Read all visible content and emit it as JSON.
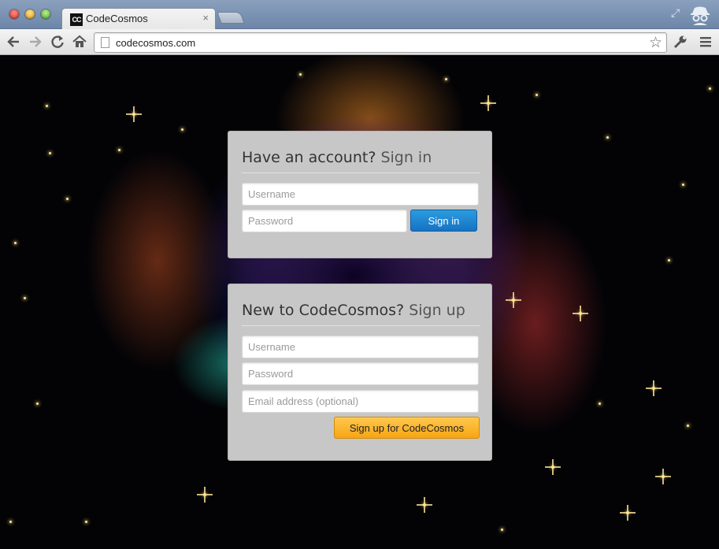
{
  "browser": {
    "tab_title": "CodeCosmos",
    "tab_favicon_text": "CC",
    "tab_close": "×",
    "url": "codecosmos.com",
    "icons": [
      "back-icon",
      "forward-icon",
      "reload-icon",
      "home-icon",
      "page-icon",
      "bookmark-star-icon",
      "wrench-icon",
      "menu-icon",
      "incognito-icon",
      "restore-icon"
    ]
  },
  "signin": {
    "heading_strong": "Have an account?",
    "heading_light": "Sign in",
    "username_placeholder": "Username",
    "password_placeholder": "Password",
    "button_label": "Sign in"
  },
  "signup": {
    "heading_strong": "New to CodeCosmos?",
    "heading_light": "Sign up",
    "username_placeholder": "Username",
    "password_placeholder": "Password",
    "email_placeholder": "Email address (optional)",
    "button_label": "Sign up for CodeCosmos"
  },
  "colors": {
    "signin_button": "#1a7fd0",
    "signup_button": "#fbb62a",
    "panel_background": "#c7c7c7"
  }
}
